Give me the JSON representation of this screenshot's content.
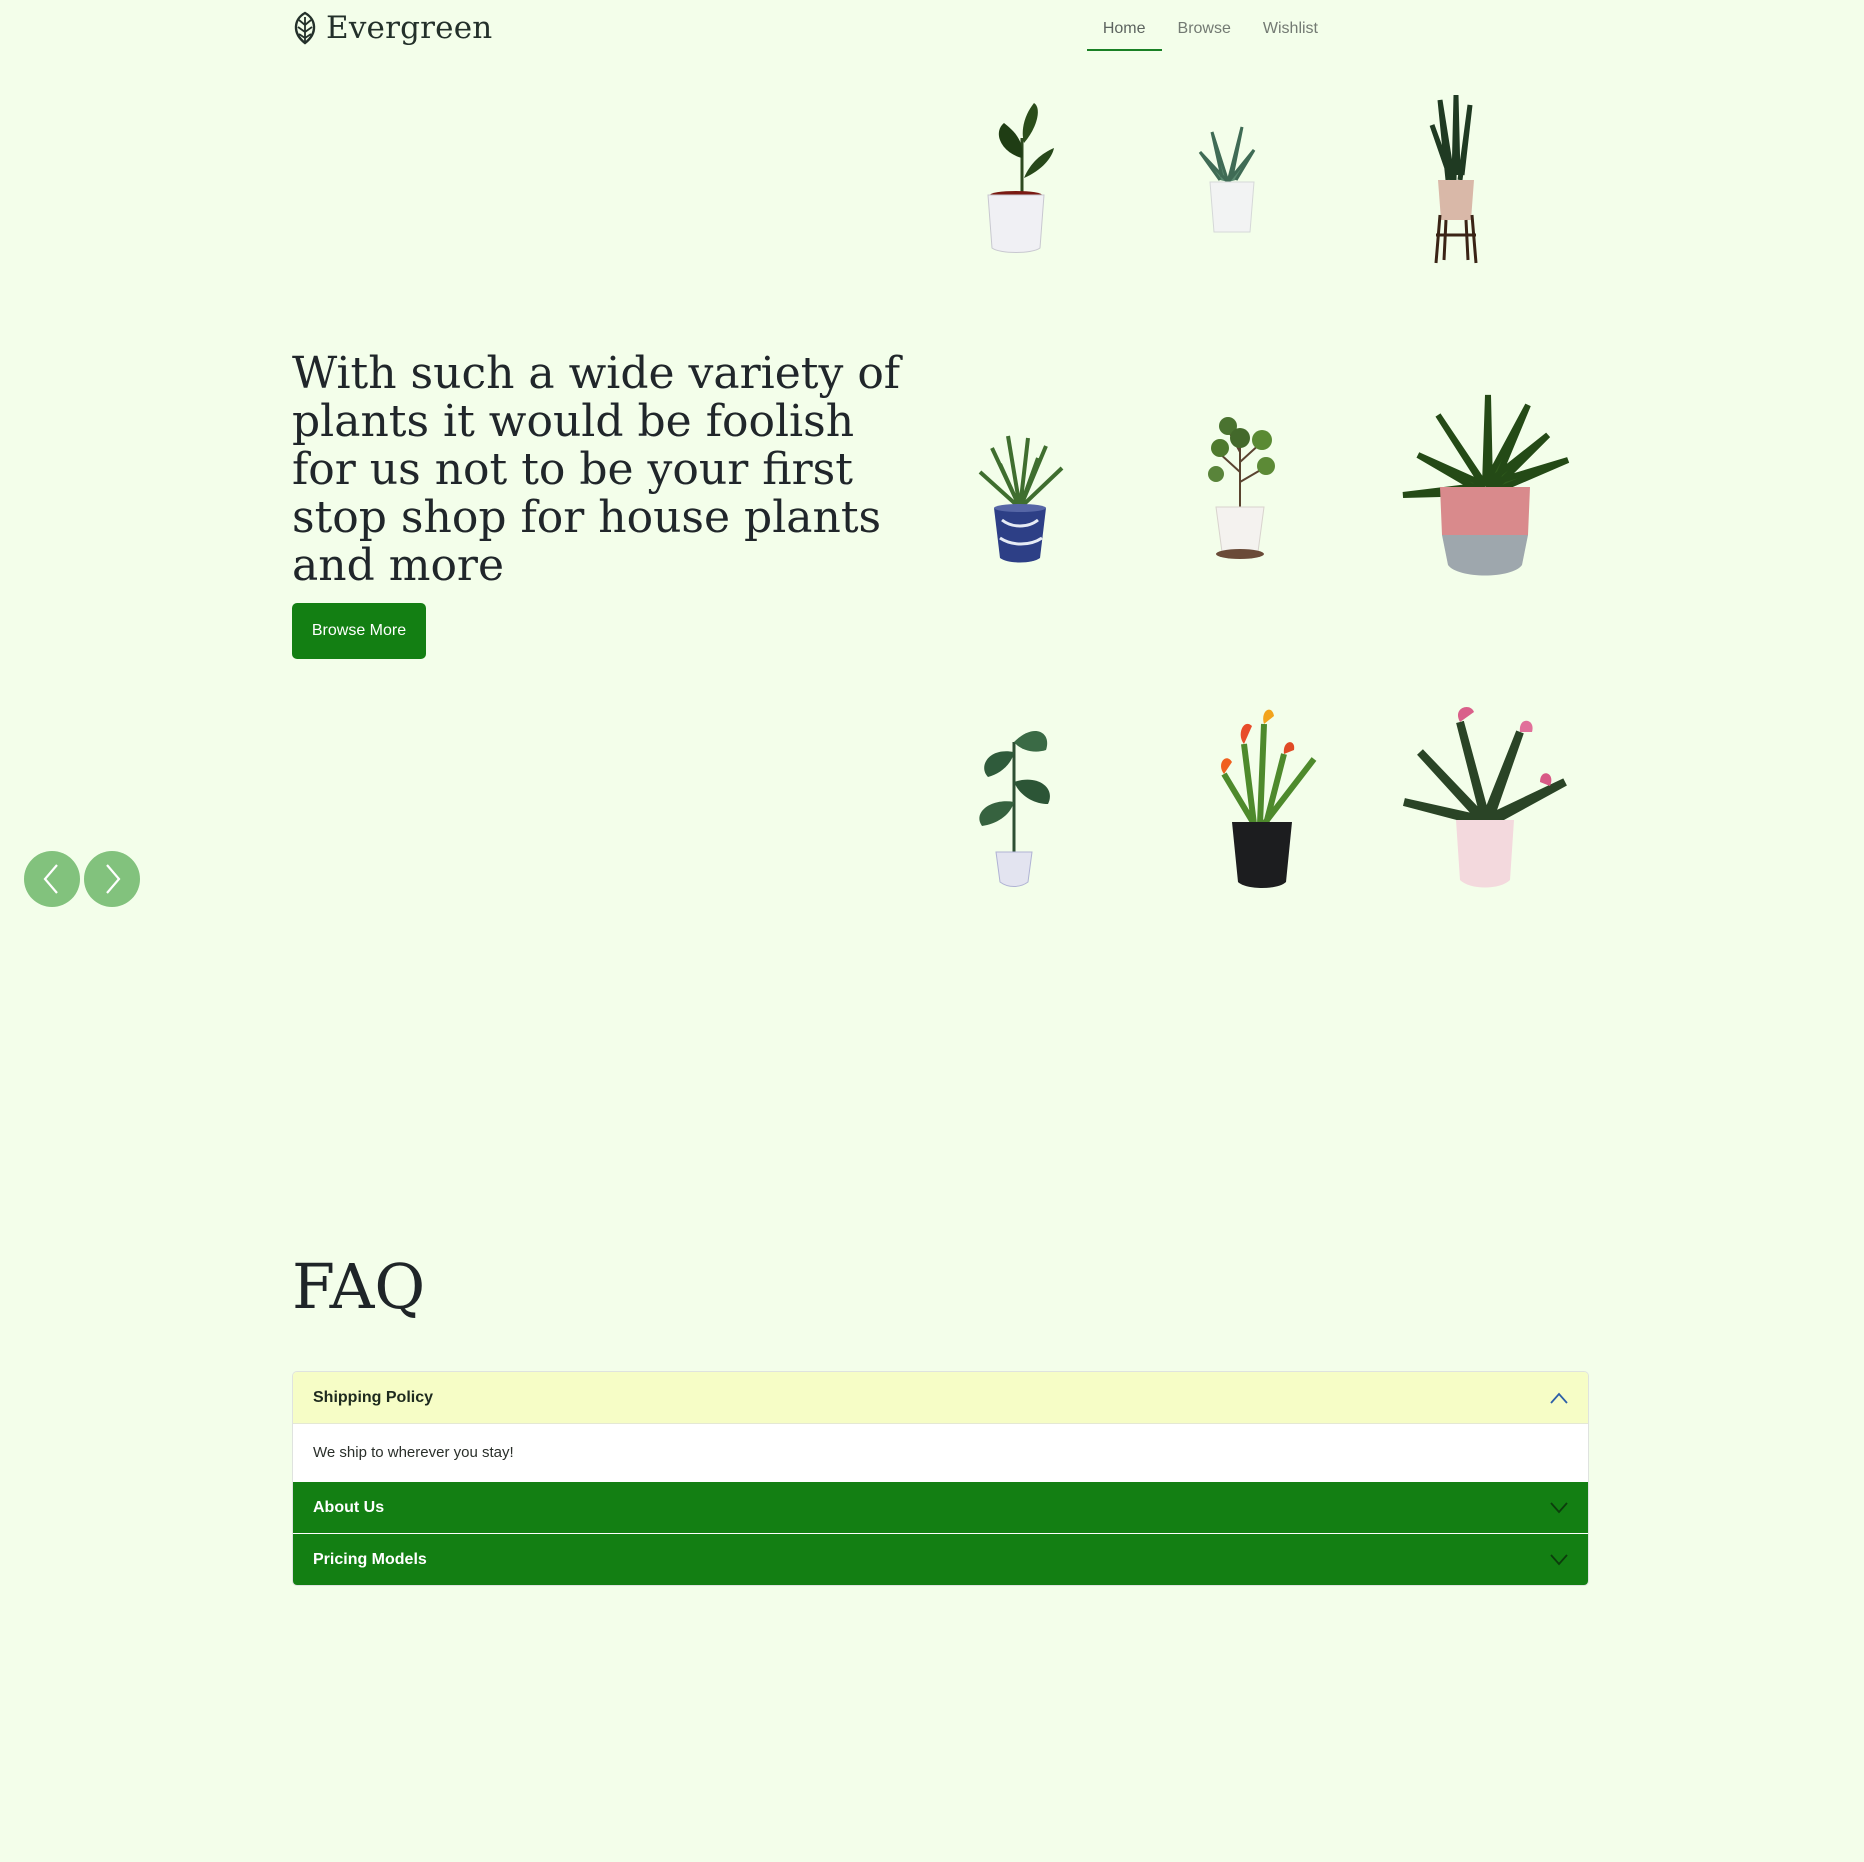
{
  "brand": {
    "name": "Evergreen",
    "icon": "leaf-icon"
  },
  "nav": [
    {
      "label": "Home",
      "active": true
    },
    {
      "label": "Browse",
      "active": false
    },
    {
      "label": "Wishlist",
      "active": false
    }
  ],
  "hero": {
    "title": "With such a wide variety of plants it would be foolish for us not to be your first stop shop for house plants and more",
    "button_label": "Browse More"
  },
  "carousel": {
    "prev_icon": "chevron-left-icon",
    "next_icon": "chevron-right-icon"
  },
  "faq": {
    "title": "FAQ",
    "items": [
      {
        "question": "Shipping Policy",
        "answer": "We ship to wherever you stay!",
        "expanded": true
      },
      {
        "question": "About Us",
        "expanded": false
      },
      {
        "question": "Pricing Models",
        "expanded": false
      }
    ]
  },
  "colors": {
    "background": "#f3feea",
    "accent": "#137f13",
    "open_header": "#f6fdc6",
    "arrow_button": "#82c27d"
  }
}
